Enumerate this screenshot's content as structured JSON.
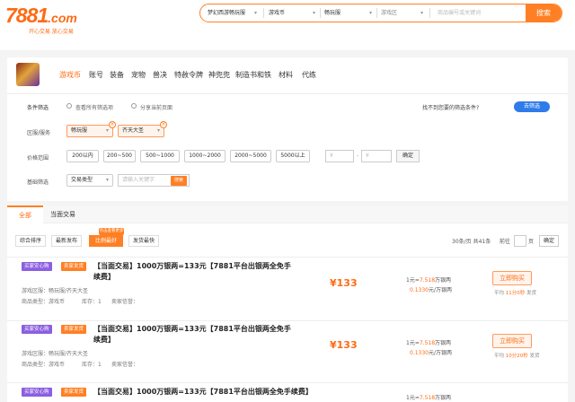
{
  "header": {
    "logo": "7881",
    "logo_suffix": ".com",
    "slogan": "开心交易 放心交易",
    "search": {
      "game": "梦幻西游畅玩服",
      "type": "游戏币",
      "server": "畅玩服",
      "area": "游戏区",
      "placeholder": "商品编号或关键词",
      "button": "搜索"
    }
  },
  "categories": {
    "tabs": [
      "游戏币",
      "账号",
      "装备",
      "宠物",
      "兽决",
      "特赦令牌",
      "神兜兜",
      "制造书和铁",
      "材料",
      "代练"
    ],
    "active": "游戏币"
  },
  "filters": {
    "cond_label": "条件筛选",
    "opt1": "查看所有筛选项",
    "opt2": "分享当前页面",
    "find_text": "找不到您要的筛选条件?",
    "try_btn": "去筛选",
    "server_label": "区服/服务",
    "server1": "畅玩服",
    "server2": "齐天大圣",
    "price_label": "价格范围",
    "prices": [
      "200以内",
      "200~500",
      "500~1000",
      "1000~2000",
      "2000~5000",
      "5000以上"
    ],
    "price_min_ph": "¥",
    "price_dash": "-",
    "price_max_ph": "¥",
    "confirm": "确定",
    "basic_label": "基础筛选",
    "trade_type": "交易类型",
    "keyword_ph": "请输入关键字",
    "search_btn": "搜索"
  },
  "listing": {
    "tab_all": "全部",
    "tab_face": "当面交易",
    "sorts": [
      "综合排序",
      "最新发布",
      "比例最好",
      "发货最快"
    ],
    "ribbon": "点击查看更多",
    "page_info": "30条/页  共41条",
    "goto": "前往",
    "page_unit": "页",
    "jump": "确定"
  },
  "items": [
    {
      "badge1": "买家安心购",
      "badge2": "卖家发货",
      "title": "【当面交易】1000万银两=133元【7881平台出银两全免手续费】",
      "server": "游戏区服：畅玩服/齐天大圣",
      "type": "商品类型：游戏币",
      "stock": "库存：1",
      "seller": "卖家信誉：",
      "price": "¥133",
      "rate1_prefix": "1元=",
      "rate1_value": "7.518",
      "rate1_suffix": "万银两",
      "rate2_value": "0.1330",
      "rate2_suffix": "元/万银两",
      "buy": "立即购买",
      "ship_prefix": "平均",
      "ship_time": "11分0秒",
      "ship_suffix": "发货"
    },
    {
      "badge1": "买家安心购",
      "badge2": "卖家发货",
      "title": "【当面交易】1000万银两=133元【7881平台出银两全免手续费】",
      "server": "游戏区服：畅玩服/齐天大圣",
      "type": "商品类型：游戏币",
      "stock": "库存：1",
      "seller": "卖家信誉：",
      "price": "¥133",
      "rate1_prefix": "1元=",
      "rate1_value": "7.518",
      "rate1_suffix": "万银两",
      "rate2_value": "0.1330",
      "rate2_suffix": "元/万银两",
      "buy": "立即购买",
      "ship_prefix": "平均",
      "ship_time": "10分20秒",
      "ship_suffix": "发货"
    },
    {
      "badge1": "买家安心购",
      "badge2": "卖家发货",
      "title": "【当面交易】1000万银两=133元【7881平台出银两全免手续费】",
      "rate1_prefix": "1元=",
      "rate1_value": "7.518",
      "rate1_suffix": "万银两"
    }
  ]
}
